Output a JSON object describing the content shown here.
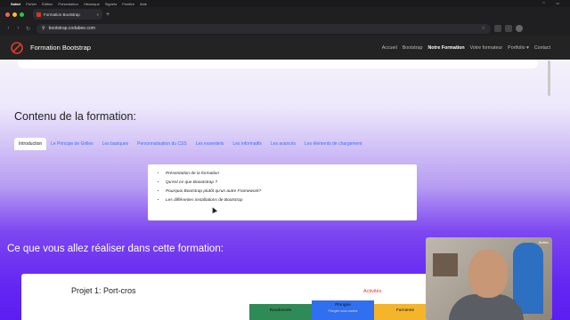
{
  "macos_menu": {
    "app": "Safari",
    "items": [
      "Fichier",
      "Édition",
      "Présentation",
      "Historique",
      "Signets",
      "Fenêtre",
      "Aide"
    ]
  },
  "browser": {
    "tab_title": "Formation Bootstrap",
    "url": "bootstrap.codabee.com"
  },
  "navbar": {
    "brand": "Formation Bootstrap",
    "links": [
      "Accueil",
      "Bootstrap",
      "Notre Formation",
      "Votre formateur",
      "Portfolio ▾",
      "Contact"
    ],
    "active_index": 2
  },
  "content": {
    "section_title": "Contenu de la formation:",
    "tabs": [
      "Introduction",
      "Le Principe de Grilles",
      "Les basiques",
      "Personnalisation du CSS",
      "Les essentiels",
      "Les informatifs",
      "Les avancés",
      "Les éléments de chargement"
    ],
    "active_tab": 0,
    "intro_items": [
      "Présentation de la formation",
      "Qu'est ce que Boootstrap ?",
      "Pourquoi Bootstrap plutôt qu'un autre Framework?",
      "Les différentes installations de Bootstrap"
    ]
  },
  "realisations": {
    "title": "Ce que vous allez réaliser dans cette formation:",
    "project_title": "Projet 1: Port-cros",
    "activities_label": "Activités",
    "badges": [
      {
        "label": "Randonnée",
        "color": "#2e8b57"
      },
      {
        "label": "Plongée",
        "color": "#2f6ff0",
        "sub": "Plongée sous-marine"
      },
      {
        "label": "Farniente",
        "color": "#f5b52a"
      }
    ]
  },
  "webcam": {
    "tag": "Baltes"
  }
}
